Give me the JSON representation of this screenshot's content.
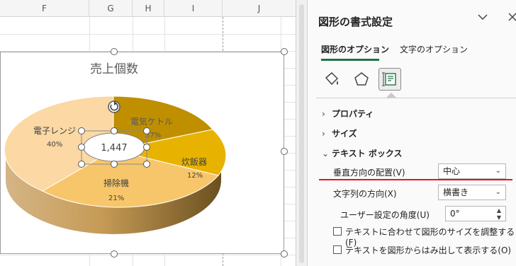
{
  "sheet": {
    "columns": [
      "F",
      "G",
      "H",
      "I",
      "J"
    ]
  },
  "chart": {
    "title": "売上個数",
    "selected_label_value": "1,447",
    "slices": [
      {
        "name": "電気ケトル",
        "percent": "27%"
      },
      {
        "name": "炊飯器",
        "percent": "12%"
      },
      {
        "name": "掃除機",
        "percent": "21%"
      },
      {
        "name": "電子レンジ",
        "percent": "40%"
      }
    ]
  },
  "chart_data": {
    "type": "pie",
    "title": "売上個数",
    "categories": [
      "電気ケトル",
      "炊飯器",
      "掃除機",
      "電子レンジ"
    ],
    "values": [
      27,
      12,
      21,
      40
    ],
    "value_unit": "%",
    "colors": [
      "#bf8f00",
      "#e8b300",
      "#f8c66a",
      "#fbd8a4"
    ]
  },
  "pane": {
    "title": "図形の書式設定",
    "tabs": {
      "shape_options": "図形のオプション",
      "text_options": "文字のオプション"
    },
    "sections": {
      "properties": "プロパティ",
      "size": "サイズ",
      "text_box": "テキスト ボックス"
    },
    "vertical_alignment": {
      "label": "垂直方向の配置(V)",
      "value": "中心"
    },
    "text_direction": {
      "label": "文字列の方向(X)",
      "value": "横書き"
    },
    "custom_angle": {
      "label": "ユーザー設定の角度(U)",
      "value": "0°"
    },
    "checkbox_resize": "テキストに合わせて図形のサイズを調整する(F)",
    "checkbox_overflow": "テキストを図形からはみ出して表示する(O)"
  },
  "colors": {
    "accent_green": "#217346",
    "annotation_red": "#e81123"
  }
}
